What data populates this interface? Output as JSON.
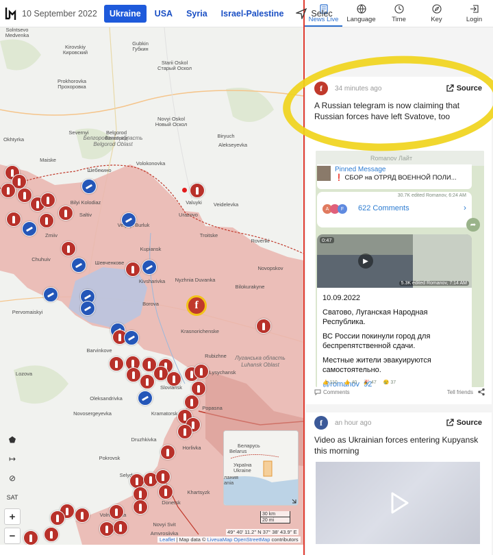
{
  "header": {
    "date": "10 September 2022",
    "tabs": [
      "Ukraine",
      "USA",
      "Syria",
      "Israel-Palestine"
    ],
    "select_label": "Selec"
  },
  "right_nav": {
    "items": [
      {
        "label": "News Live",
        "icon": "news-icon",
        "active": true
      },
      {
        "label": "Language",
        "icon": "language-icon"
      },
      {
        "label": "Time",
        "icon": "clock-icon"
      },
      {
        "label": "Key",
        "icon": "compass-icon"
      },
      {
        "label": "Login",
        "icon": "login-icon"
      }
    ]
  },
  "map": {
    "labels": [
      {
        "text": "Solntsevo"
      },
      {
        "text": "Medvenka"
      },
      {
        "text": "Kirovskiy"
      },
      {
        "text": "Кировский"
      },
      {
        "text": "Gubkin"
      },
      {
        "text": "Губкин"
      },
      {
        "text": "Starii Oskol"
      },
      {
        "text": "Старый Оскол"
      },
      {
        "text": "Prokhorovka"
      },
      {
        "text": "Прохоровка"
      },
      {
        "text": "Novyi Oskol"
      },
      {
        "text": "Новый Оскол"
      },
      {
        "text": "Severnyi"
      },
      {
        "text": "Belgorod"
      },
      {
        "text": "Белгород"
      },
      {
        "text": "Okhtyrka"
      },
      {
        "text": "Maiske"
      },
      {
        "text": "Шебекино"
      },
      {
        "text": "Volokonovka"
      },
      {
        "text": "Biryuch"
      },
      {
        "text": "Alekseyevka"
      },
      {
        "text": "Bilyi Kolodiaz"
      },
      {
        "text": "Valuyki"
      },
      {
        "text": "Veidelevka"
      },
      {
        "text": "Urazovo"
      },
      {
        "text": "Saltiv"
      },
      {
        "text": "Velykyi Burluk"
      },
      {
        "text": "Kupiansk"
      },
      {
        "text": "Rovenki"
      },
      {
        "text": "Troitske"
      },
      {
        "text": "Nyzhnia Duvanka"
      },
      {
        "text": "Kivsharivka"
      },
      {
        "text": "Bilokurakyne"
      },
      {
        "text": "Novopskov"
      },
      {
        "text": "Borova"
      },
      {
        "text": "Chuhuiv"
      },
      {
        "text": "Krasnorichenske"
      },
      {
        "text": "Rubizhne"
      },
      {
        "text": "Lysychansk"
      },
      {
        "text": "Barvinkove"
      },
      {
        "text": "Sloviansk"
      },
      {
        "text": "Kramatorsk"
      },
      {
        "text": "Druzhkivka"
      },
      {
        "text": "Popasna"
      },
      {
        "text": "Oleksandrivka"
      },
      {
        "text": "Pokrovsk"
      },
      {
        "text": "Selydove"
      },
      {
        "text": "Donetsk"
      },
      {
        "text": "Horlivka"
      },
      {
        "text": "Khartsyzk"
      },
      {
        "text": "Amvrosiivka"
      },
      {
        "text": "Lozova"
      },
      {
        "text": "Pervomaiskyi"
      },
      {
        "text": "Zmiiv"
      },
      {
        "text": "Novosergeyevka"
      },
      {
        "text": "Volnovakha"
      },
      {
        "text": "Novyi Svit"
      },
      {
        "text": "Шевченкове"
      }
    ],
    "oblasts": [
      {
        "text": "Белгородская область"
      },
      {
        "text": "Belgorod Oblast"
      },
      {
        "text": "Луганська область"
      },
      {
        "text": "Luhansk Oblast"
      }
    ],
    "controls": [
      "⬟",
      "↦",
      "⊘",
      "SAT",
      "+",
      "−"
    ],
    "minimap_labels": [
      "Беларусь",
      "Belarus",
      "Україна",
      "Ukraine",
      "лания",
      "ania"
    ],
    "scale": [
      "30 km",
      "20 mi"
    ],
    "coords": "49° 40' 11.2'' N 37° 38' 43.9'' E",
    "attribution": {
      "leaflet": "Leaflet",
      "sep": " | Map data © ",
      "provider": "LiveuaMap",
      "osm": "OpenStreetMap",
      "suffix": " contributors"
    }
  },
  "feed": {
    "card1": {
      "time": "34 minutes ago",
      "source": "Source",
      "text": "A Russian telegram is now claiming that Russian forces have left Svatove, too",
      "telegram": {
        "channel": "Romanov Лайт",
        "pinned_title": "Pinned Message",
        "pinned_text": "❗ СБОР на ОТРЯД ВОЕННОЙ ПОЛИ...",
        "views1": "30.7K edited Romanov, 6:24 AM",
        "comments": "622 Comments",
        "video_time": "0:47",
        "views2": "5.3K edited Romanov, 7:14 AM",
        "date": "10.09.2022",
        "p1": "Сватово, Луганская Народная Республика.",
        "p2": "ВС России покинули город для беспрепятственной сдачи.",
        "p3": "Местные жители эвакуируются самостоятельно.",
        "link": "@romanov_92",
        "reactions": [
          "👍 110",
          "👍 40",
          "🎉 47",
          "😢 37"
        ]
      },
      "comments_label": "Comments",
      "tell_friends": "Tell friends"
    },
    "card2": {
      "time": "an hour ago",
      "source": "Source",
      "text": "Video as Ukrainian forces entering Kupyansk this morning"
    }
  },
  "colors": {
    "accent": "#1e5adb",
    "occupied": "#e9b6b0",
    "marker_red": "#b8312a",
    "marker_blue": "#2456b8",
    "highlight": "#f0d41c"
  }
}
